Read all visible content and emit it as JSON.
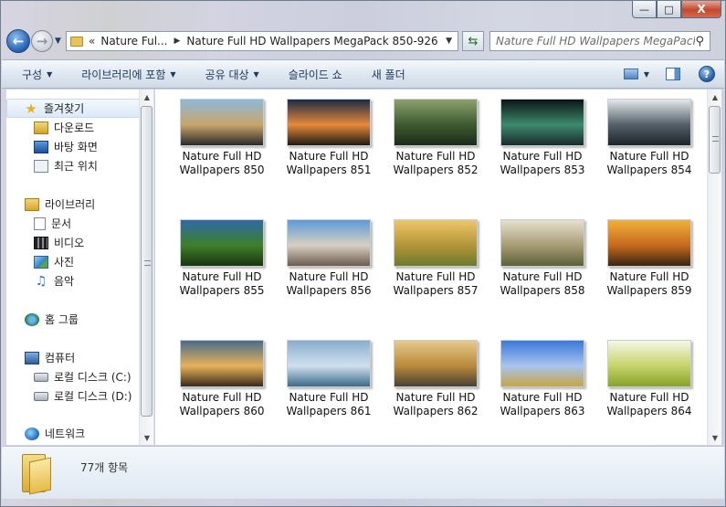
{
  "window": {
    "caption_buttons": {
      "minimize": "—",
      "maximize": "□",
      "close": "X"
    }
  },
  "address": {
    "overflow_chevron": "«",
    "crumbs": [
      "Nature Ful...",
      "Nature Full HD Wallpapers MegaPack 850-926"
    ],
    "search_placeholder": "Nature Full HD Wallpapers MegaPack..."
  },
  "toolbar": {
    "organize": "구성",
    "include_in_library": "라이브러리에 포함",
    "share_with": "공유 대상",
    "slide_show": "슬라이드 쇼",
    "new_folder": "새 폴더",
    "help": "?"
  },
  "nav": {
    "favorites": "즐겨찾기",
    "downloads": "다운로드",
    "desktop": "바탕 화면",
    "recent": "최근 위치",
    "libraries": "라이브러리",
    "documents": "문서",
    "videos": "비디오",
    "pictures": "사진",
    "music": "음악",
    "homegroup": "홈 그룹",
    "computer": "컴퓨터",
    "drive_c": "로컬 디스크 (C:)",
    "drive_d": "로컬 디스크 (D:)",
    "network": "네트워크"
  },
  "files": [
    {
      "line1": "Nature Full HD",
      "line2": "Wallpapers 850",
      "colors": [
        "#8fb8d8",
        "#c9a66b",
        "#2b2a2a"
      ]
    },
    {
      "line1": "Nature Full HD",
      "line2": "Wallpapers 851",
      "colors": [
        "#1c2a45",
        "#e7893a",
        "#1f1a14"
      ]
    },
    {
      "line1": "Nature Full HD",
      "line2": "Wallpapers 852",
      "colors": [
        "#8da06d",
        "#3e5a31",
        "#1d2a18"
      ]
    },
    {
      "line1": "Nature Full HD",
      "line2": "Wallpapers 853",
      "colors": [
        "#0c1416",
        "#3c8a6d",
        "#1a2a2c"
      ]
    },
    {
      "line1": "Nature Full HD",
      "line2": "Wallpapers 854",
      "colors": [
        "#e4e8ea",
        "#55606a",
        "#1c2429"
      ]
    },
    {
      "line1": "Nature Full HD",
      "line2": "Wallpapers 855",
      "colors": [
        "#2f6aa7",
        "#3f7f2a",
        "#17350f"
      ]
    },
    {
      "line1": "Nature Full HD",
      "line2": "Wallpapers 856",
      "colors": [
        "#5b9bd8",
        "#d9cfc1",
        "#6c5c4d"
      ]
    },
    {
      "line1": "Nature Full HD",
      "line2": "Wallpapers 857",
      "colors": [
        "#f0c66b",
        "#b2953a",
        "#6d7a2c"
      ]
    },
    {
      "line1": "Nature Full HD",
      "line2": "Wallpapers 858",
      "colors": [
        "#e7e0cf",
        "#a79c76",
        "#5b6137"
      ]
    },
    {
      "line1": "Nature Full HD",
      "line2": "Wallpapers 859",
      "colors": [
        "#f2b03a",
        "#c66a1e",
        "#3a2512"
      ]
    },
    {
      "line1": "Nature Full HD",
      "line2": "Wallpapers 860",
      "colors": [
        "#4a6a8c",
        "#e6b25a",
        "#3a2a1a"
      ]
    },
    {
      "line1": "Nature Full HD",
      "line2": "Wallpapers 861",
      "colors": [
        "#8aaed0",
        "#cfe0ee",
        "#3a6b8a"
      ]
    },
    {
      "line1": "Nature Full HD",
      "line2": "Wallpapers 862",
      "colors": [
        "#e8c98a",
        "#b98a3c",
        "#4a4034"
      ]
    },
    {
      "line1": "Nature Full HD",
      "line2": "Wallpapers 863",
      "colors": [
        "#3b78d8",
        "#a8c4ee",
        "#c7a545"
      ]
    },
    {
      "line1": "Nature Full HD",
      "line2": "Wallpapers 864",
      "colors": [
        "#f6f7e8",
        "#c6d36a",
        "#86a32a"
      ]
    }
  ],
  "details": {
    "item_count": "77개 항목"
  }
}
